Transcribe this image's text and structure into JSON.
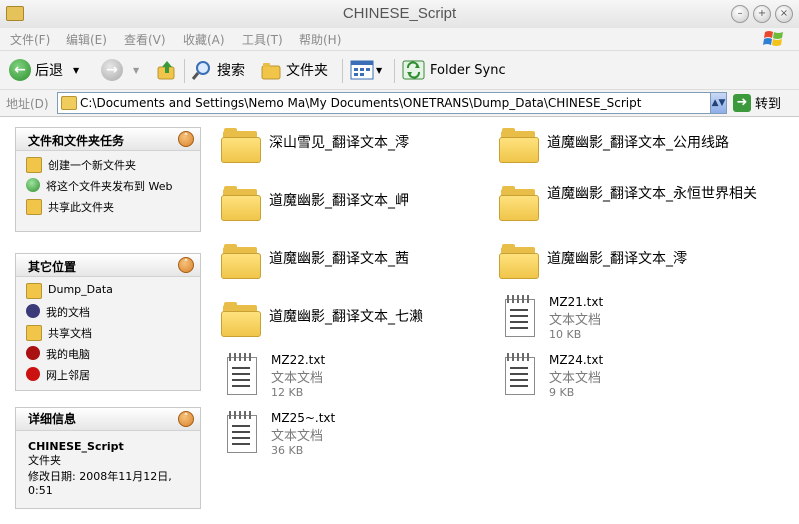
{
  "window": {
    "title": "CHINESE_Script"
  },
  "menu": [
    {
      "label": "文件(F)"
    },
    {
      "label": "编辑(E)"
    },
    {
      "label": "查看(V)"
    },
    {
      "label": "收藏(A)"
    },
    {
      "label": "工具(T)"
    },
    {
      "label": "帮助(H)"
    }
  ],
  "toolbar": {
    "back_label": "后退",
    "search_label": "搜索",
    "folders_label": "文件夹",
    "folder_sync_label": "Folder Sync"
  },
  "address": {
    "label": "地址(D)",
    "path": "C:\\Documents and Settings\\Nemo Ma\\My Documents\\ONETRANS\\Dump_Data\\CHINESE_Script",
    "go_label": "转到"
  },
  "tasks_panel": {
    "title": "文件和文件夹任务",
    "items": [
      {
        "label": "创建一个新文件夹",
        "icon": "new-folder-icon"
      },
      {
        "label": "将这个文件夹发布到 Web",
        "icon": "publish-web-icon"
      },
      {
        "label": "共享此文件夹",
        "icon": "share-folder-icon"
      }
    ]
  },
  "places_panel": {
    "title": "其它位置",
    "items": [
      {
        "label": "Dump_Data",
        "icon": "folder-icon"
      },
      {
        "label": "我的文档",
        "icon": "my-documents-icon"
      },
      {
        "label": "共享文档",
        "icon": "shared-documents-icon"
      },
      {
        "label": "我的电脑",
        "icon": "my-computer-icon"
      },
      {
        "label": "网上邻居",
        "icon": "network-places-icon"
      }
    ]
  },
  "details_panel": {
    "title": "详细信息",
    "name": "CHINESE_Script",
    "type": "文件夹",
    "modified": "修改日期: 2008年11月12日, 0:51"
  },
  "folders": [
    {
      "name": "深山雪见_翻译文本_澪"
    },
    {
      "name": "道魔幽影_翻译文本_公用线路"
    },
    {
      "name": "道魔幽影_翻译文本_岬"
    },
    {
      "name": "道魔幽影_翻译文本_永恒世界相关"
    },
    {
      "name": "道魔幽影_翻译文本_茜"
    },
    {
      "name": "道魔幽影_翻译文本_澪"
    },
    {
      "name": "道魔幽影_翻译文本_七濑"
    }
  ],
  "files": [
    {
      "name": "MZ21.txt",
      "type": "文本文档",
      "size": "10 KB"
    },
    {
      "name": "MZ22.txt",
      "type": "文本文档",
      "size": "12 KB"
    },
    {
      "name": "MZ24.txt",
      "type": "文本文档",
      "size": "9 KB"
    },
    {
      "name": "MZ25~.txt",
      "type": "文本文档",
      "size": "36 KB"
    }
  ]
}
